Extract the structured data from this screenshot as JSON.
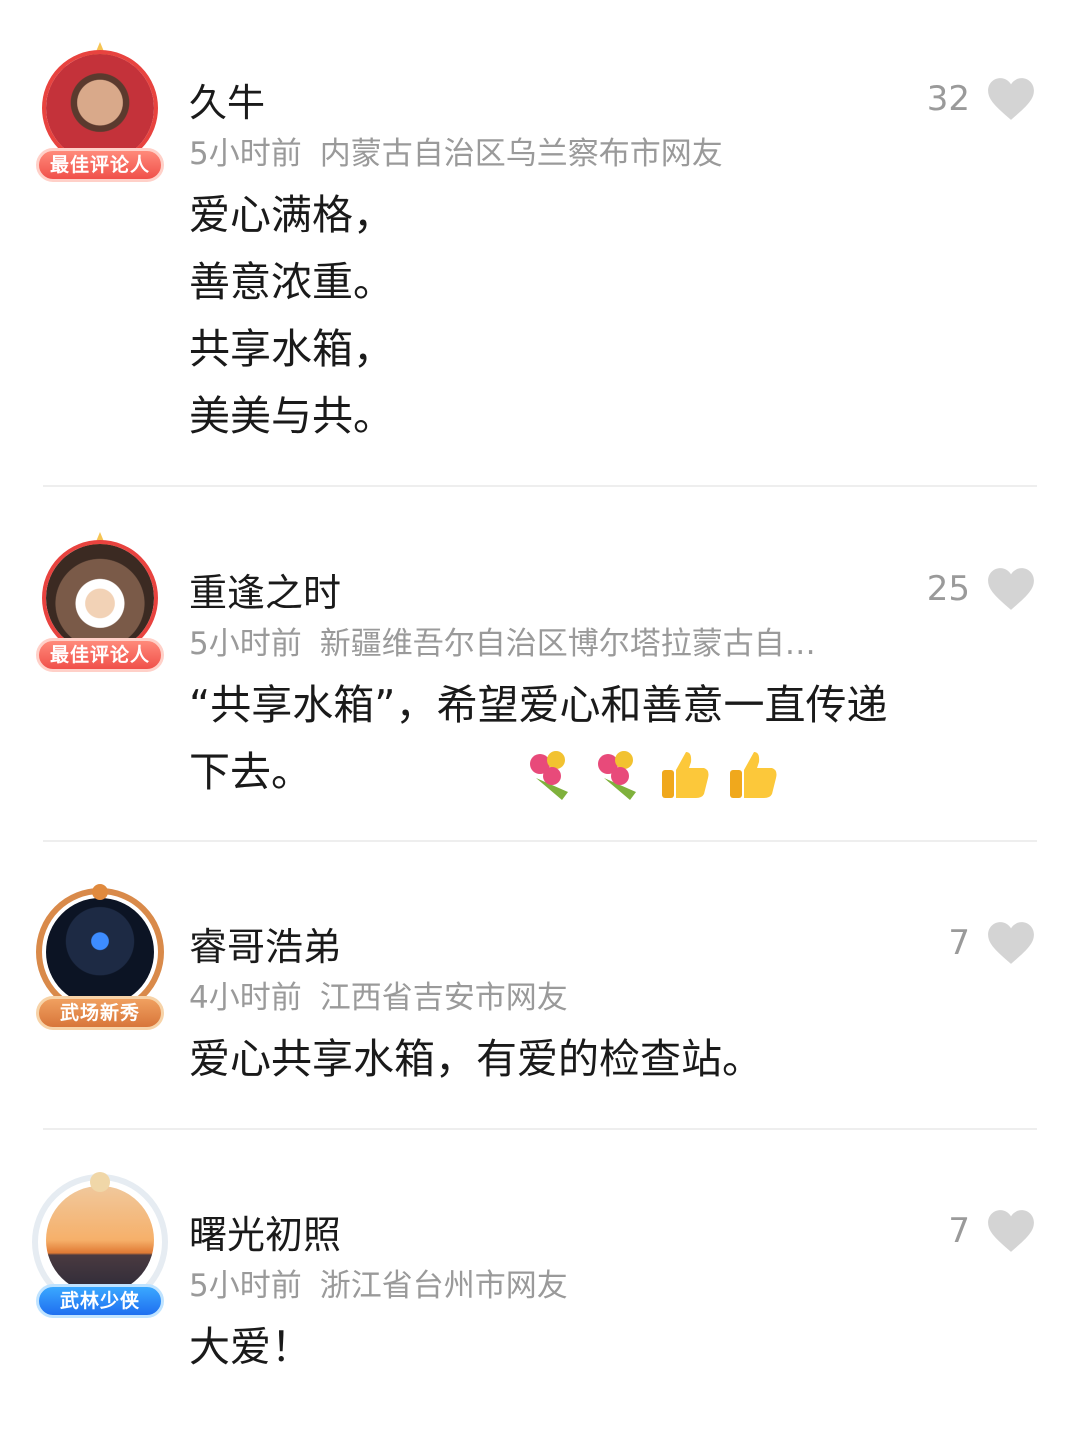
{
  "comments": [
    {
      "name": "久牛",
      "time": "5小时前",
      "location": "内蒙古自治区乌兰察布市网友",
      "likes": "32",
      "badge": "最佳评论人",
      "text_lines": [
        "爱心满格，",
        "善意浓重。",
        "共享水箱，",
        "美美与共。"
      ]
    },
    {
      "name": "重逢之时",
      "time": "5小时前",
      "location": "新疆维吾尔自治区博尔塔拉蒙古自…",
      "likes": "25",
      "badge": "最佳评论人",
      "text_lines": [
        "“共享水箱”，希望爱心和善意一直传递",
        "下去。"
      ],
      "emojis": [
        "bouquet",
        "bouquet",
        "thumbs-up",
        "thumbs-up"
      ]
    },
    {
      "name": "睿哥浩弟",
      "time": "4小时前",
      "location": "江西省吉安市网友",
      "likes": "7",
      "badge": "武场新秀",
      "text_lines": [
        "爱心共享水箱，有爱的检查站。"
      ]
    },
    {
      "name": "曙光初照",
      "time": "5小时前",
      "location": "浙江省台州市网友",
      "likes": "7",
      "badge": "武林少侠",
      "text_lines": [
        "大爱！"
      ]
    }
  ],
  "colors": {
    "meta": "#9a9a9a",
    "heart": "#d4d4d4",
    "divider": "#eeeeee"
  }
}
